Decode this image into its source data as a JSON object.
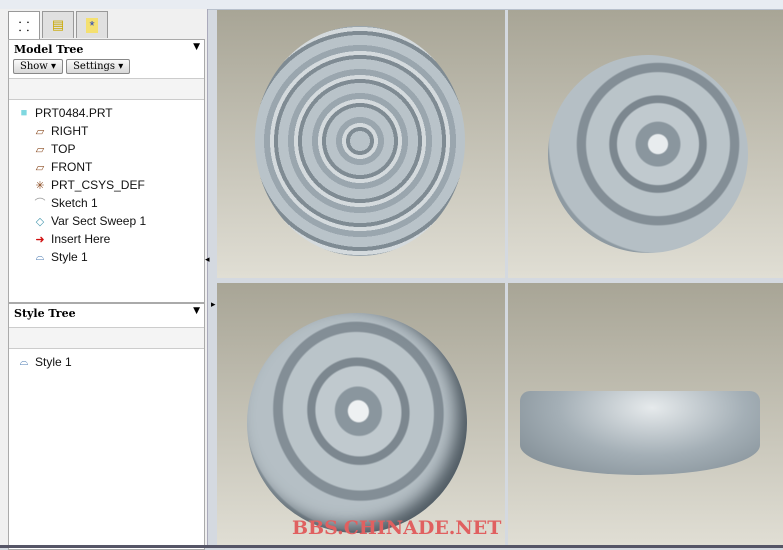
{
  "tabs": [
    {
      "icon": "model-tree-icon"
    },
    {
      "icon": "folder-browser-icon"
    },
    {
      "icon": "favorites-folder-icon"
    }
  ],
  "model_tree": {
    "title": "Model Tree",
    "show_label": "Show ▾",
    "settings_label": "Settings ▾",
    "items": [
      {
        "label": "PRT0484.PRT",
        "icon": "part-icon",
        "glyph": "■"
      },
      {
        "label": "RIGHT",
        "icon": "datum-plane-icon",
        "glyph": "▱"
      },
      {
        "label": "TOP",
        "icon": "datum-plane-icon",
        "glyph": "▱"
      },
      {
        "label": "FRONT",
        "icon": "datum-plane-icon",
        "glyph": "▱"
      },
      {
        "label": "PRT_CSYS_DEF",
        "icon": "coordinate-system-icon",
        "glyph": "✳"
      },
      {
        "label": "Sketch 1",
        "icon": "sketch-icon",
        "glyph": "⌒"
      },
      {
        "label": "Var Sect Sweep 1",
        "icon": "sweep-icon",
        "glyph": "◇"
      },
      {
        "label": "Insert Here",
        "icon": "insert-arrow-icon",
        "glyph": "➜"
      },
      {
        "label": "Style 1",
        "icon": "style-icon",
        "glyph": "⌓"
      }
    ]
  },
  "style_tree": {
    "title": "Style Tree",
    "items": [
      {
        "label": "Style 1",
        "icon": "style-icon",
        "glyph": "⌓"
      }
    ]
  },
  "watermark": "BBS.CHINADE.NET",
  "colors": {
    "viewport_top": "#a8a596",
    "viewport_bottom": "#e0ded4",
    "model": "#9aa6ae",
    "watermark": "#e06060"
  }
}
